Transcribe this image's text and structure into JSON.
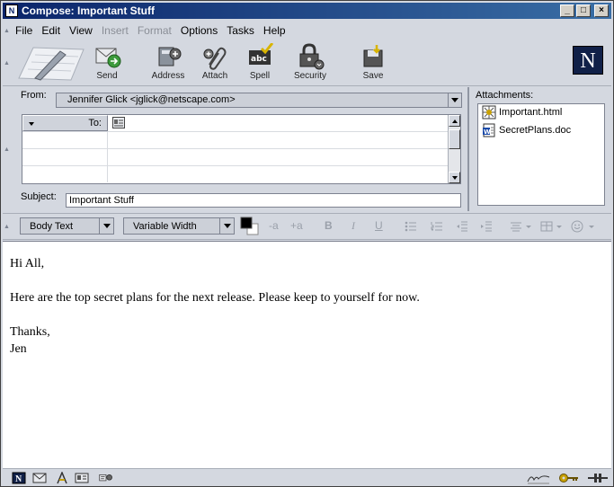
{
  "window": {
    "title": "Compose: Important Stuff",
    "min_glyph": "_",
    "max_glyph": "□",
    "close_glyph": "×"
  },
  "app_icon_letter": "N",
  "menu": [
    {
      "label": "File",
      "enabled": true
    },
    {
      "label": "Edit",
      "enabled": true
    },
    {
      "label": "View",
      "enabled": true
    },
    {
      "label": "Insert",
      "enabled": false
    },
    {
      "label": "Format",
      "enabled": false
    },
    {
      "label": "Options",
      "enabled": true
    },
    {
      "label": "Tasks",
      "enabled": true
    },
    {
      "label": "Help",
      "enabled": true
    }
  ],
  "toolbar": {
    "send": "Send",
    "address": "Address",
    "attach": "Attach",
    "spell": "Spell",
    "security": "Security",
    "save": "Save",
    "logo": "N"
  },
  "header": {
    "from_label": "From:",
    "from_value": "Jennifer Glick <jglick@netscape.com>",
    "recipients": [
      {
        "type": "To:",
        "address": ""
      },
      {
        "type": "",
        "address": ""
      },
      {
        "type": "",
        "address": ""
      },
      {
        "type": "",
        "address": ""
      }
    ],
    "subject_label": "Subject:",
    "subject_value": "Important Stuff",
    "attachments_label": "Attachments:",
    "attachments": [
      {
        "name": "Important.html",
        "icon": "html-file-icon"
      },
      {
        "name": "SecretPlans.doc",
        "icon": "word-doc-icon"
      }
    ]
  },
  "format": {
    "paragraph_style": "Body Text",
    "font": "Variable Width",
    "text_color": "#000000",
    "bg_color": "#ffffff",
    "smaller": "-a",
    "larger": "+a",
    "bold": "B",
    "italic": "I",
    "underline": "U",
    "icons": [
      "bullet-list-icon",
      "numbered-list-icon",
      "outdent-icon",
      "indent-icon",
      "align-icon",
      "insert-icon",
      "smiley-icon"
    ]
  },
  "body": {
    "lines": [
      "Hi All,",
      "Here are the top secret plans for the next release. Please keep to yourself for now.",
      "Thanks,",
      "Jen"
    ]
  },
  "status": {
    "icons": [
      "navigator-icon",
      "mail-icon",
      "composer-icon",
      "address-book-icon",
      "chat-icon",
      "signed-icon",
      "key-icon",
      "online-icon"
    ]
  }
}
